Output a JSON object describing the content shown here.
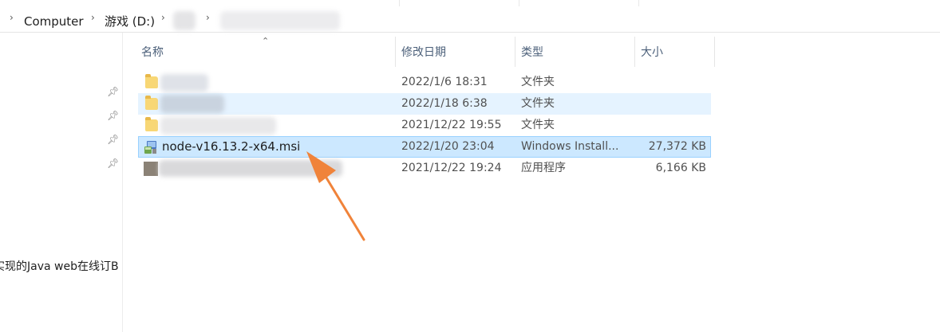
{
  "breadcrumb": {
    "items": [
      "Computer",
      "游戏 (D:)"
    ]
  },
  "columns": {
    "name": "名称",
    "modified": "修改日期",
    "type": "类型",
    "size": "大小"
  },
  "files": [
    {
      "name": "",
      "modified": "2022/1/6 18:31",
      "type": "文件夹",
      "size": "",
      "icon": "folder-icon"
    },
    {
      "name": "",
      "modified": "2022/1/18 6:38",
      "type": "文件夹",
      "size": "",
      "icon": "folder-icon"
    },
    {
      "name": "",
      "modified": "2021/12/22 19:55",
      "type": "文件夹",
      "size": "",
      "icon": "folder-icon"
    },
    {
      "name": "node-v16.13.2-x64.msi",
      "modified": "2022/1/20 23:04",
      "type": "Windows Install...",
      "size": "27,372 KB",
      "icon": "msi-installer-icon"
    },
    {
      "name": "",
      "modified": "2021/12/22 19:24",
      "type": "应用程序",
      "size": "6,166 KB",
      "icon": "application-icon"
    }
  ],
  "navpane": {
    "truncated_item": "实现的Java web在线订B"
  },
  "colors": {
    "selected_row": "#cce8ff",
    "hover_row": "#e5f3ff",
    "arrow": "#f0833a"
  }
}
